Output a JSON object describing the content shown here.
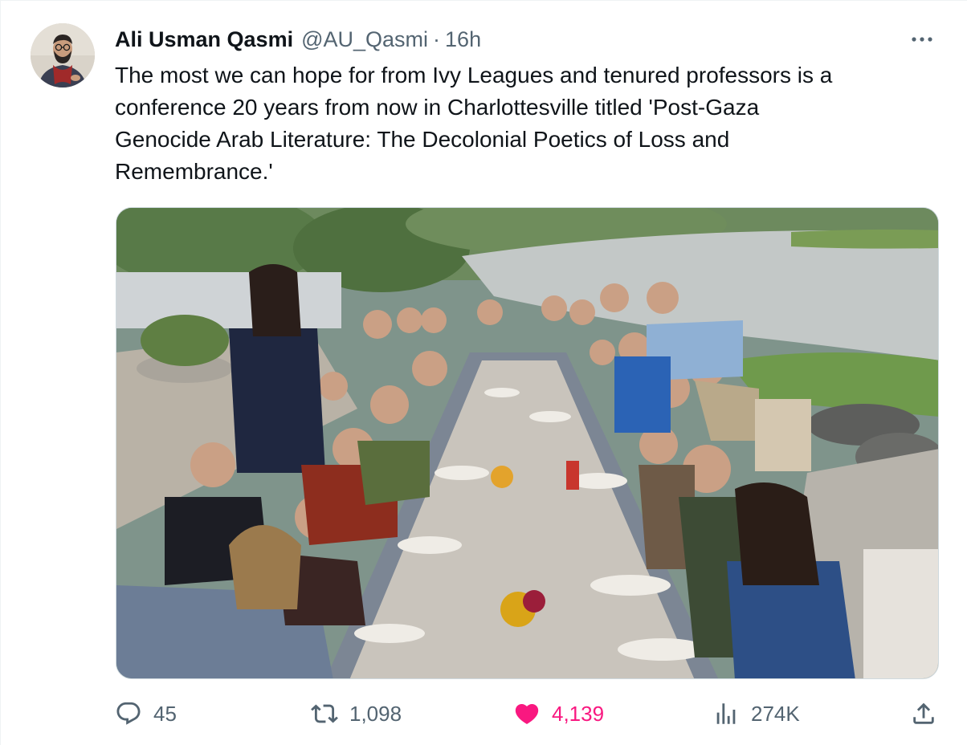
{
  "tweet": {
    "author": {
      "display_name": "Ali Usman Qasmi",
      "handle": "@AU_Qasmi",
      "separator": "·",
      "time": "16h"
    },
    "text": "The most we can hope for from Ivy Leagues and tenured professors is a\nconference 20 years from now in Charlottesville titled 'Post-Gaza\nGenocide Arab Literature: The Decolonial Poetics of Loss and\nRemembrance.'",
    "media": {
      "kind": "photo",
      "icon": "photo"
    },
    "actions": {
      "replies": "45",
      "retweets": "1,098",
      "likes": "4,139",
      "views": "274K"
    },
    "icons": {
      "more": "more-icon",
      "reply": "reply-icon",
      "retweet": "retweet-icon",
      "like": "heart-icon",
      "views": "views-icon",
      "share": "share-icon"
    },
    "colors": {
      "like_accent": "#f91880",
      "secondary_text": "#536471",
      "primary_text": "#0f1419"
    }
  }
}
